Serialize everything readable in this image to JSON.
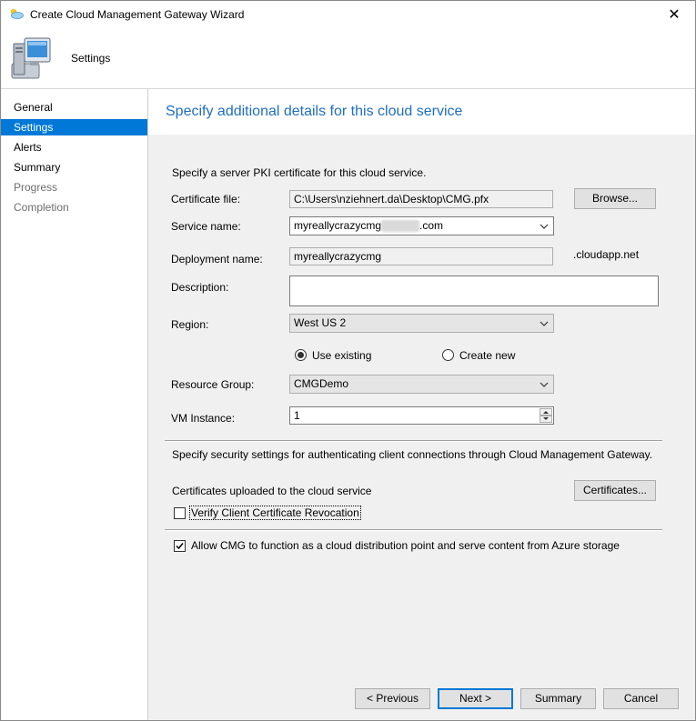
{
  "window": {
    "title": "Create Cloud Management Gateway Wizard",
    "close_glyph": "✕",
    "app_icon": "cloud-icon",
    "header_icon": "computer-icon",
    "header_title": "Settings"
  },
  "sidebar": {
    "items": [
      {
        "label": "General",
        "state": "normal"
      },
      {
        "label": "Settings",
        "state": "active"
      },
      {
        "label": "Alerts",
        "state": "normal"
      },
      {
        "label": "Summary",
        "state": "normal"
      },
      {
        "label": "Progress",
        "state": "disabled"
      },
      {
        "label": "Completion",
        "state": "disabled"
      }
    ]
  },
  "page": {
    "heading": "Specify additional details for this cloud service",
    "pki_intro": "Specify a server PKI certificate for this cloud service.",
    "certificate_file": {
      "label": "Certificate file:",
      "value": "C:\\Users\\nziehnert.da\\Desktop\\CMG.pfx"
    },
    "browse_button": "Browse...",
    "service_name": {
      "label": "Service name:",
      "value_prefix": "myreallycrazycmg",
      "value_suffix": ".com"
    },
    "deployment_name": {
      "label": "Deployment name:",
      "value": "myreallycrazycmg",
      "suffix": ".cloudapp.net"
    },
    "description": {
      "label": "Description:",
      "value": ""
    },
    "region": {
      "label": "Region:",
      "value": "West US 2"
    },
    "resource_group_options": {
      "use_existing": "Use existing",
      "create_new": "Create new",
      "selected": "use_existing"
    },
    "resource_group": {
      "label": "Resource Group:",
      "value": "CMGDemo"
    },
    "vm_instance": {
      "label": "VM Instance:",
      "value": "1"
    },
    "security_intro": "Specify security settings for authenticating client connections through Cloud Management Gateway.",
    "certs_uploaded_label": "Certificates uploaded to the cloud service",
    "certificates_button": "Certificates...",
    "verify_revocation": {
      "label": "Verify Client Certificate Revocation",
      "checked": false
    },
    "allow_cdp": {
      "label": "Allow CMG to function as a cloud distribution point and serve content from Azure storage",
      "checked": true
    }
  },
  "buttons": {
    "previous": "< Previous",
    "next": "Next >",
    "summary": "Summary",
    "cancel": "Cancel"
  },
  "colors": {
    "accent": "#0078d7",
    "heading": "#1e6fc2"
  }
}
